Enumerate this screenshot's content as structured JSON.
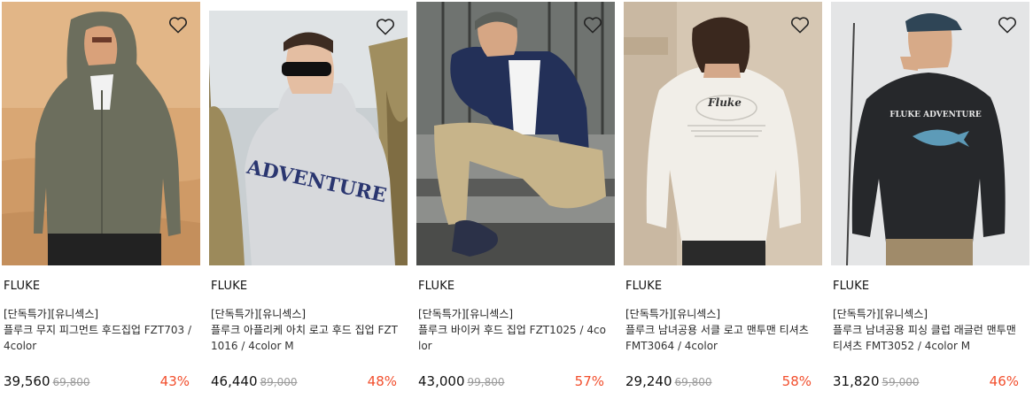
{
  "products": [
    {
      "brand": "FLUKE",
      "tag": "[단독특가][유니섹스]",
      "name": "플루크 무지 피그먼트 후드집업 ",
      "code": "FZT703 / 4color",
      "price": "39,560",
      "original_price": "69,800",
      "discount": "43%",
      "wishlist_icon": "heart-outline-icon"
    },
    {
      "brand": "FLUKE",
      "tag": "[단독특가][유니섹스]",
      "name": "플루크 아플리케 아치 로고 후드 집업 ",
      "code": "FZT1016 / 4color M",
      "price": "46,440",
      "original_price": "89,000",
      "discount": "48%",
      "wishlist_icon": "heart-outline-icon"
    },
    {
      "brand": "FLUKE",
      "tag": "[단독특가][유니섹스]",
      "name": "플루크 바이커 후드 집업 ",
      "code": "FZT1025 / 4color",
      "price": "43,000",
      "original_price": "99,800",
      "discount": "57%",
      "wishlist_icon": "heart-outline-icon"
    },
    {
      "brand": "FLUKE",
      "tag": "[단독특가][유니섹스]",
      "name": "플루크 남녀공용 서클 로고 맨투맨 티셔츠 ",
      "code": "FMT3064 / 4color",
      "price": "29,240",
      "original_price": "69,800",
      "discount": "58%",
      "wishlist_icon": "heart-outline-icon"
    },
    {
      "brand": "FLUKE",
      "tag": "[단독특가][유니섹스]",
      "name": "플루크 남녀공용 피싱 클럽 래글런 맨투맨티셔츠 ",
      "code": "FMT3052 / 4color M",
      "price": "31,820",
      "original_price": "59,000",
      "discount": "46%",
      "wishlist_icon": "heart-outline-icon"
    }
  ],
  "print_text": {
    "card2": "ADVENTURE",
    "card4": "Fluke",
    "card5": "FLUKE ADVENTURE"
  },
  "colors": {
    "discount": "#f24e2c",
    "original_price": "#9a9a9a"
  }
}
